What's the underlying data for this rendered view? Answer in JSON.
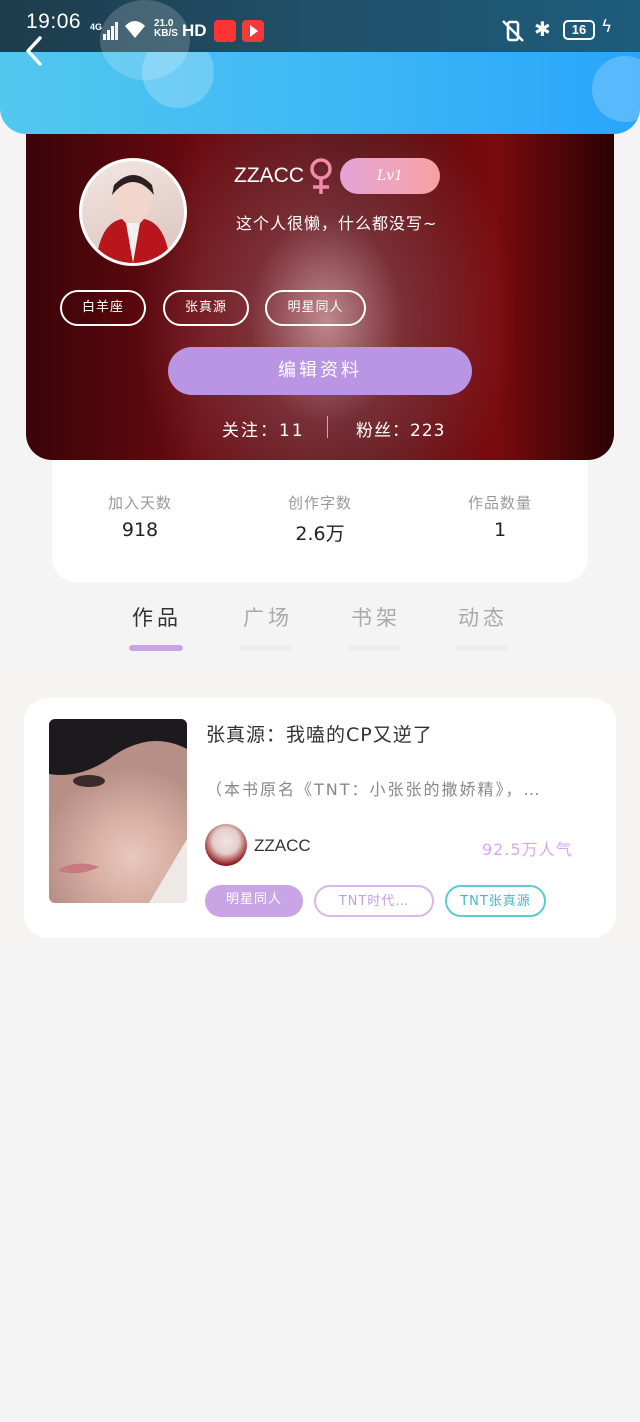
{
  "status_bar": {
    "time": "19:06",
    "network": "4G",
    "speed_value": "21.0",
    "speed_unit": "KB/S",
    "hd": "HD",
    "battery": "16"
  },
  "colors": {
    "header": "#3eb7f5",
    "accent_purple": "#b995e4",
    "level_pink": "#f0a4b9",
    "tab_active": "#c9a5e6",
    "tag_teal": "#5cc9d6"
  },
  "profile": {
    "username": "ZZACC",
    "gender_icon": "female-icon",
    "level": "Lv1",
    "bio": "这个人很懒，什么都没写~",
    "tags": [
      "白羊座",
      "张真源",
      "明星同人"
    ],
    "edit_label": "编辑资料",
    "follow": "关注：11",
    "fans": "粉丝：223"
  },
  "stats": [
    {
      "label": "加入天数",
      "value": "918"
    },
    {
      "label": "创作字数",
      "value": "2.6万"
    },
    {
      "label": "作品数量",
      "value": "1"
    }
  ],
  "tabs": [
    "作品",
    "广场",
    "书架",
    "动态"
  ],
  "works": [
    {
      "title": "张真源：我嗑的CP又逆了",
      "description": "（本书原名《TNT：小张张的撒娇精》，…",
      "author": "ZZACC",
      "popularity": "92.5万人气",
      "tags": [
        "明星同人",
        "TNT时代…",
        "TNT张真源"
      ]
    }
  ]
}
